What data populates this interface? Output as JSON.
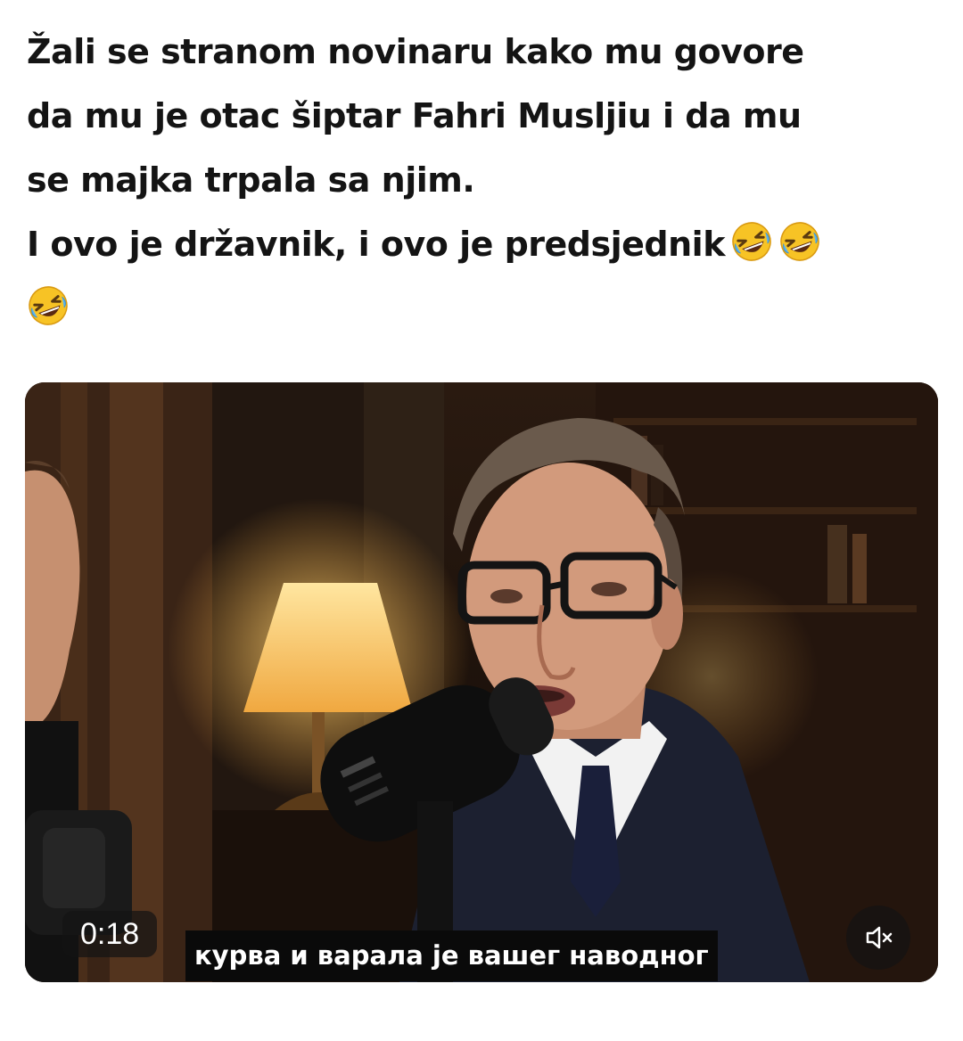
{
  "post": {
    "lines": [
      "Žali se stranom novinaru kako mu govore",
      "da mu je otac šiptar Fahri Musljiu i da mu",
      "se majka trpala sa njim.",
      "I ovo je državnik, i ovo je predsjednik"
    ],
    "emojis": [
      "rolling-on-floor-laughing",
      "rolling-on-floor-laughing",
      "rolling-on-floor-laughing"
    ]
  },
  "video": {
    "timestamp": "0:18",
    "subtitle": "курва и варала је вашег наводног",
    "mute_icon": "speaker-muted-icon"
  },
  "colors": {
    "text": "#141414",
    "overlay": "#141414",
    "emoji_yellow": "#f7c325"
  }
}
